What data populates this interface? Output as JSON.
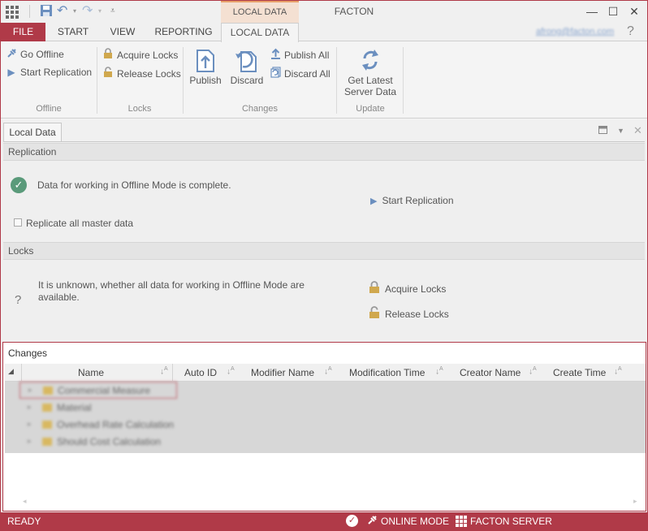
{
  "title_bar": {
    "context_tab": "LOCAL DATA",
    "app_title": "FACTON",
    "minimize": "—",
    "maximize": "☐",
    "close": "✕"
  },
  "ribbon_tabs": {
    "file": "FILE",
    "start": "START",
    "view": "VIEW",
    "reporting": "REPORTING",
    "local_data": "LOCAL DATA",
    "user_email": "afrong@facton.com",
    "help": "?"
  },
  "ribbon": {
    "offline": {
      "go_offline": "Go Offline",
      "start_replication": "Start Replication",
      "label": "Offline"
    },
    "locks": {
      "acquire": "Acquire Locks",
      "release": "Release Locks",
      "label": "Locks"
    },
    "changes": {
      "publish": "Publish",
      "discard": "Discard",
      "publish_all": "Publish All",
      "discard_all": "Discard All",
      "label": "Changes"
    },
    "update": {
      "get_latest_1": "Get Latest",
      "get_latest_2": "Server Data",
      "label": "Update"
    }
  },
  "doc_tab": {
    "label": "Local Data"
  },
  "replication": {
    "header": "Replication",
    "status": "Data for working in Offline Mode is complete.",
    "start_replication": "Start Replication",
    "replicate_all": "Replicate all master data"
  },
  "locks_section": {
    "header": "Locks",
    "status_line1": "It is unknown, whether all data for working in Offline Mode are",
    "status_line2": "available.",
    "acquire": "Acquire Locks",
    "release": "Release Locks",
    "question": "?"
  },
  "changes": {
    "title": "Changes",
    "columns": [
      "Name",
      "Auto ID",
      "Modifier Name",
      "Modification Time",
      "Creator Name",
      "Create Time"
    ],
    "rows": [
      "Commercial Measure",
      "Material",
      "Overhead Rate Calculation",
      "Should Cost Calculation"
    ]
  },
  "status_bar": {
    "ready": "READY",
    "online_mode": "ONLINE MODE",
    "server": "FACTON SERVER"
  }
}
